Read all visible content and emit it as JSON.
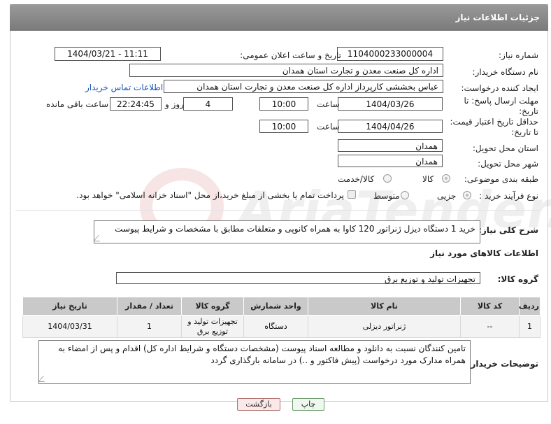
{
  "header": {
    "title": "جزئیات اطلاعات نیاز"
  },
  "watermark": {
    "text": "AriaTender.neT"
  },
  "form": {
    "need_number": {
      "label": "شماره نیاز:",
      "value": "1104000233000004"
    },
    "announce_datetime": {
      "label": "تاریخ و ساعت اعلان عمومی:",
      "value": "1404/03/21 - 11:11"
    },
    "buyer_org": {
      "label": "نام دستگاه خریدار:",
      "value": "اداره کل صنعت  معدن و تجارت استان همدان"
    },
    "requester": {
      "label": "ایجاد کننده درخواست:",
      "value": "عباس بخششی کارپرداز اداره کل صنعت  معدن و تجارت استان همدان",
      "contact_link": "اطلاعات تماس خریدار"
    },
    "reply_deadline": {
      "label_line1": "مهلت ارسال پاسخ: تا",
      "label_line2": "تاریخ:",
      "date": "1404/03/26",
      "time_label": "ساعت",
      "time": "10:00",
      "days": "4",
      "days_label": "روز و",
      "remaining": "22:24:45",
      "remaining_label": "ساعت باقی مانده"
    },
    "price_validity": {
      "label_line1": "حداقل تاریخ اعتبار قیمت:",
      "label_line2": "تا تاریخ:",
      "date": "1404/04/26",
      "time_label": "ساعت",
      "time": "10:00"
    },
    "delivery_province": {
      "label": "استان محل تحویل:",
      "value": "همدان"
    },
    "delivery_city": {
      "label": "شهر محل تحویل:",
      "value": "همدان"
    },
    "category": {
      "label": "طبقه بندی موضوعی:",
      "options": [
        "کالا",
        "کالا/خدمت"
      ],
      "selected": "کالا"
    },
    "purchase_type": {
      "label": "نوع فرآیند خرید :",
      "options": [
        "جزیی",
        "متوسط"
      ],
      "selected": "جزیی",
      "payment_note": "پرداخت تمام یا بخشی از مبلغ خرید،از محل \"اسناد خزانه اسلامی\" خواهد بود."
    },
    "description": {
      "label": "شرح کلی نیاز:",
      "value": "خرید 1 دستگاه دیزل ژنراتور 120 کاوا به همراه کانوپی و متعلقات مطابق با مشخصات و شرایط پیوست"
    }
  },
  "goods": {
    "section_title": "اطلاعات کالاهای مورد نیاز",
    "group_label": "گروه کالا:",
    "group_value": "تجهیزات تولید و توزیع برق",
    "columns": [
      "ردیف",
      "کد کالا",
      "نام کالا",
      "واحد شمارش",
      "گروه کالا",
      "تعداد / مقدار",
      "تاریخ نیاز"
    ],
    "rows": [
      [
        "1",
        "--",
        "ژنراتور دیزلی",
        "دستگاه",
        "تجهیزات تولید و توزیع برق",
        "1",
        "1404/03/31"
      ]
    ]
  },
  "buyer_notes": {
    "label": "توضیحات خریدار:",
    "value": "تامین کنندگان نسبت به دانلود و مطالعه اسناد پیوست (مشخصات دستگاه و شرایط اداره کل) اقدام و پس از امضاء به همراه مدارک مورد درخواست (پیش فاکتور و ..) در سامانه بارگذاری گردد"
  },
  "buttons": {
    "print": "چاپ",
    "back": "بازگشت"
  }
}
